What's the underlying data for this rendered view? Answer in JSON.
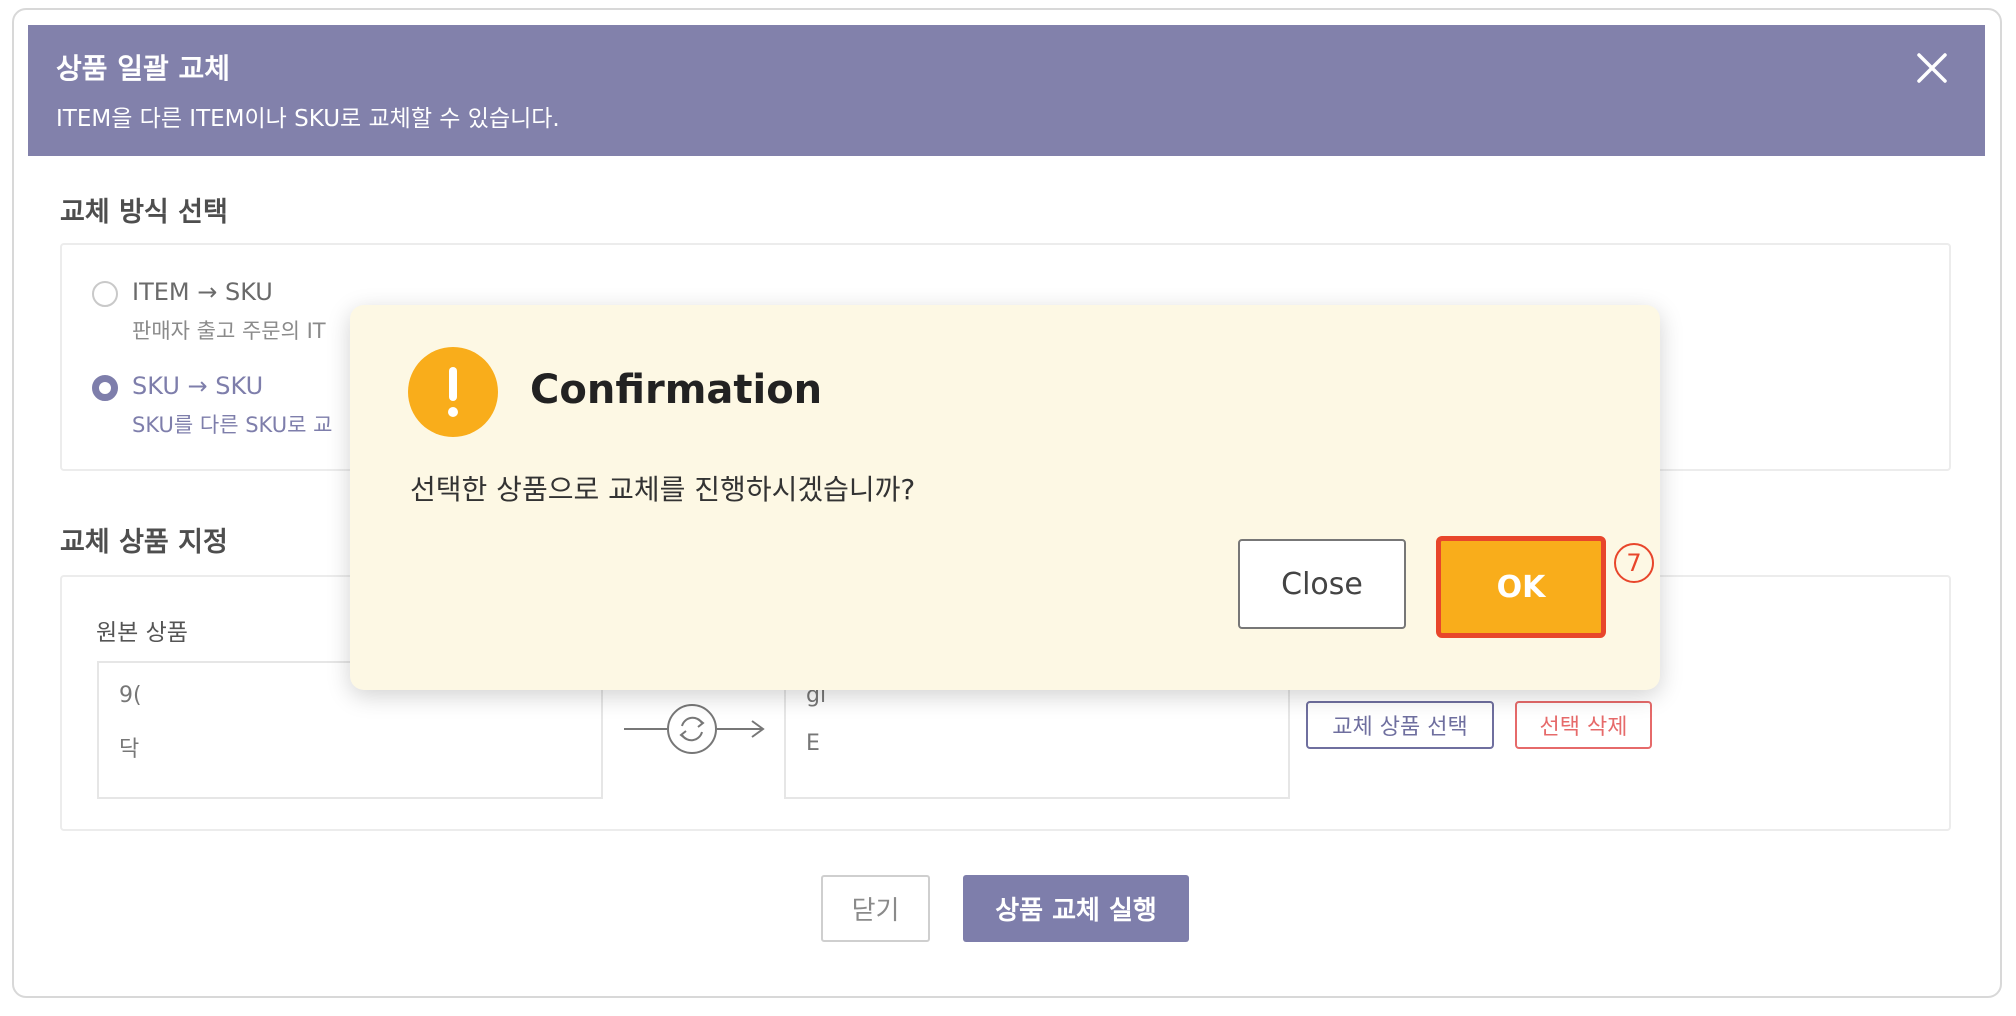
{
  "header": {
    "title": "상품 일괄 교체",
    "subtitle": "ITEM을 다른 ITEM이나 SKU로 교체할 수 있습니다."
  },
  "method_section": {
    "title": "교체 방식 선택",
    "options": [
      {
        "label": "ITEM → SKU",
        "desc": "판매자 출고 주문의 IT",
        "checked": false
      },
      {
        "label": "SKU → SKU",
        "desc": "SKU를 다른 SKU로 교",
        "checked": true
      }
    ]
  },
  "target_section": {
    "title": "교체 상품 지정",
    "source_label": "원본 상품",
    "source_lines": [
      "9(",
      "닥"
    ],
    "target_lines": [
      "gi",
      "E"
    ],
    "select_button": "교체 상품 선택",
    "delete_button": "선택 삭제"
  },
  "footer": {
    "close_button": "닫기",
    "execute_button": "상품 교체 실행"
  },
  "dialog": {
    "title": "Confirmation",
    "message": "선택한 상품으로 교체를 진행하시겠습니까?",
    "close_button": "Close",
    "ok_button": "OK",
    "step_marker": "7"
  },
  "icons": {
    "close": "close-icon",
    "swap": "refresh-icon",
    "warning": "exclamation-icon"
  },
  "colors": {
    "header_bg": "#8281ab",
    "accent": "#7e7eab",
    "dialog_bg": "#fdf8e4",
    "warning": "#f9ad1b",
    "highlight": "#e8462b",
    "delete_text": "#e66a6a"
  }
}
